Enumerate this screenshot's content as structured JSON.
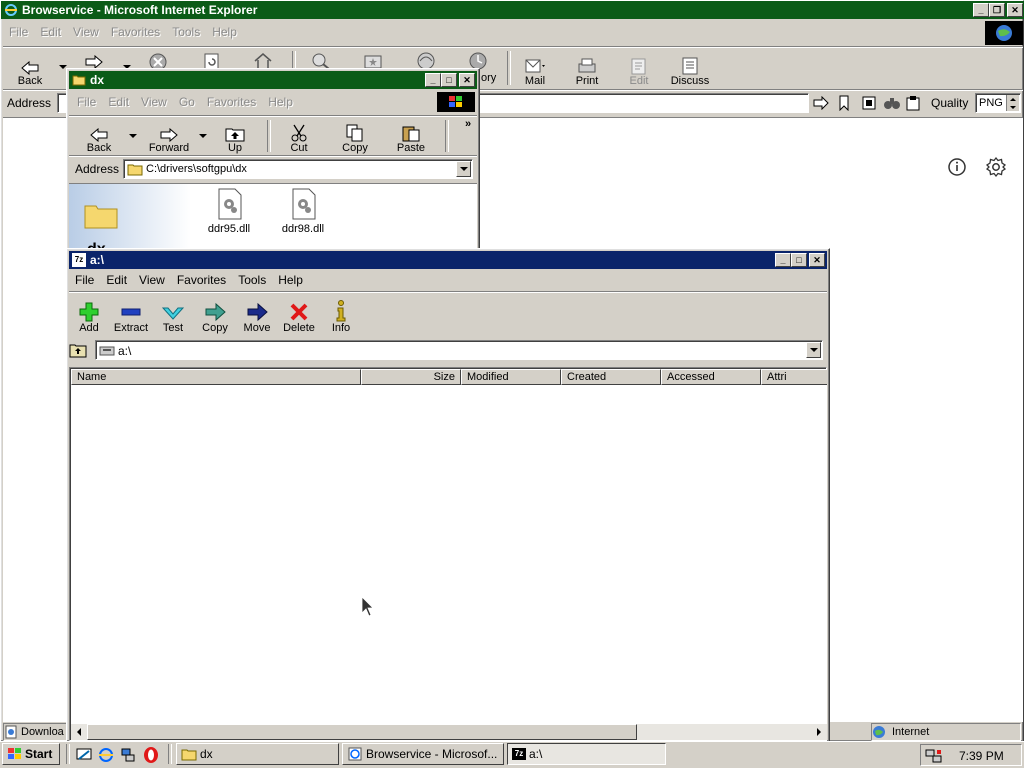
{
  "ie": {
    "title": "Browservice - Microsoft Internet Explorer",
    "menu": [
      "File",
      "Edit",
      "View",
      "Favorites",
      "Tools",
      "Help"
    ],
    "toolbar": {
      "back": "Back",
      "history_fragment": "ory",
      "mail": "Mail",
      "print": "Print",
      "edit": "Edit",
      "discuss": "Discuss"
    },
    "address_label": "Address",
    "quality_label": "Quality",
    "quality_value": "PNG",
    "status_left": "Downloa",
    "status_zone": "Internet"
  },
  "dx": {
    "title": "dx",
    "menu": [
      "File",
      "Edit",
      "View",
      "Go",
      "Favorites",
      "Help"
    ],
    "toolbar": {
      "back": "Back",
      "forward": "Forward",
      "up": "Up",
      "cut": "Cut",
      "copy": "Copy",
      "paste": "Paste",
      "more": "»"
    },
    "address_label": "Address",
    "address_value": "C:\\drivers\\softgpu\\dx",
    "files": [
      "ddr95.dll",
      "ddr98.dll"
    ]
  },
  "sevenzip": {
    "title": "a:\\",
    "menu": [
      "File",
      "Edit",
      "View",
      "Favorites",
      "Tools",
      "Help"
    ],
    "toolbar": {
      "add": "Add",
      "extract": "Extract",
      "test": "Test",
      "copy": "Copy",
      "move": "Move",
      "delete": "Delete",
      "info": "Info"
    },
    "path": "a:\\",
    "columns": [
      "Name",
      "Size",
      "Modified",
      "Created",
      "Accessed",
      "Attri"
    ]
  },
  "taskbar": {
    "start": "Start",
    "tasks": [
      "dx",
      "Browservice - Microsof...",
      "a:\\"
    ],
    "clock": "7:39 PM"
  },
  "colors": {
    "ie_title": "#0b5b17",
    "dx_title": "#0b5b17",
    "sevenzip_title": "#0a246a",
    "face": "#d4d0c8"
  }
}
